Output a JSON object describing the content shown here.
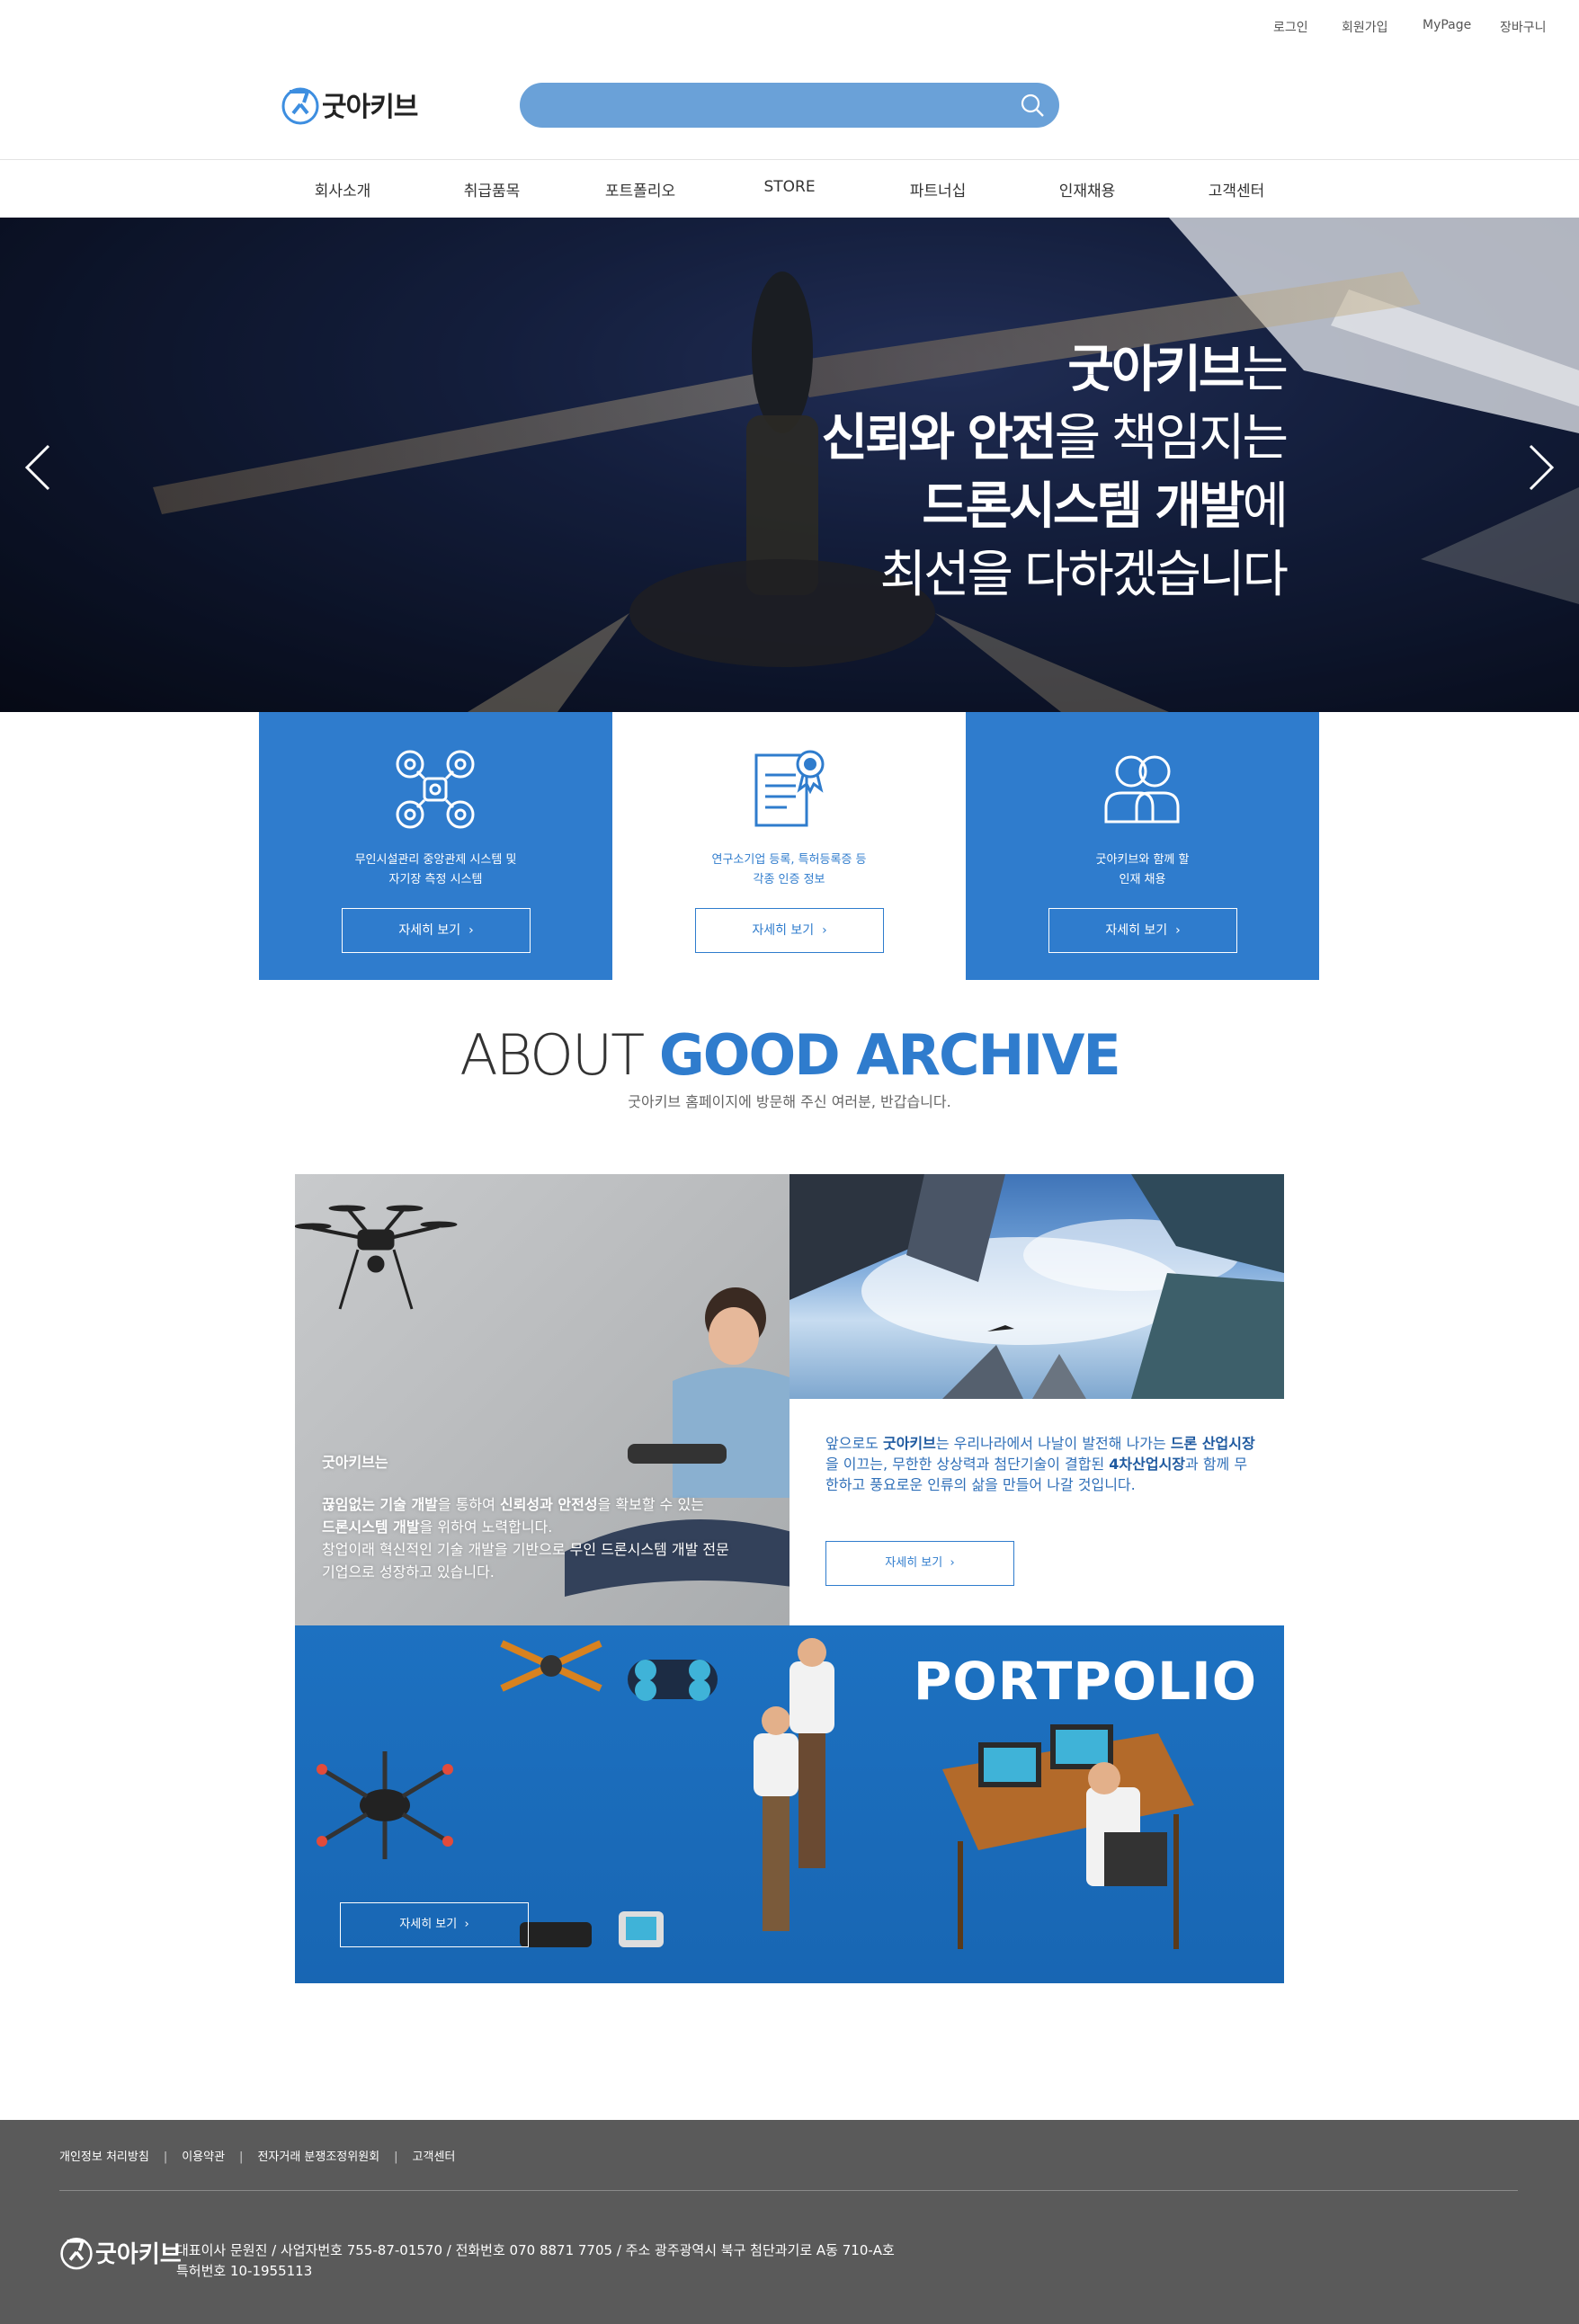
{
  "util_links": [
    "로그인",
    "회원가입",
    "MyPage",
    "장바구니"
  ],
  "logo": {
    "text": "굿아키브"
  },
  "search": {
    "placeholder": ""
  },
  "nav": [
    "회사소개",
    "취급품목",
    "포트폴리오",
    "STORE",
    "파트너십",
    "인재채용",
    "고객센터"
  ],
  "hero": {
    "line1_bold": "굿아키브",
    "line1_rest": "는",
    "line2_bold": "신뢰와 안전",
    "line2_rest": "을 책임지는",
    "line3_bold": "드론시스템 개발",
    "line3_rest": "에",
    "line4": "최선을 다하겠습니다"
  },
  "cards": [
    {
      "desc": "무인시설관리 중앙관제 시스템 및\n자기장 측정 시스템",
      "button": "자세히 보기",
      "icon": "drone-icon"
    },
    {
      "desc": "연구소기업 등록, 특허등록증 등\n각종 인증 정보",
      "button": "자세히 보기",
      "icon": "certificate-icon"
    },
    {
      "desc": "굿아키브와 함께 할\n인재 채용",
      "button": "자세히 보기",
      "icon": "people-icon"
    }
  ],
  "about": {
    "title_light": "ABOUT",
    "title_bold": "GOOD ARCHIVE",
    "subtitle": "굿아키브 홈페이지에 방문해 주신 여러분, 반갑습니다.",
    "photo_text": {
      "l1": "굿아키브는",
      "l2a": "끊임없는 기술 개발",
      "l2b": "을 통하여 ",
      "l2c": "신뢰성과 안전성",
      "l2d": "을 확보할 수 있는",
      "l3a": "드론시스템 개발",
      "l3b": "을 위하여 노력합니다.",
      "l4": "창업이래 혁신적인 기술 개발을 기반으로 무인 드론시스템 개발 전문",
      "l5": "기업으로 성장하고 있습니다."
    },
    "right_text": {
      "a": "앞으로도 ",
      "b": "굿아키브",
      "c": "는 우리나라에서 나날이 발전해 나가는 ",
      "d": "드론 산업시장",
      "e": "을 이끄는, 무한한 상상력과 첨단기술이 결합된 ",
      "f": "4차산업시장",
      "g": "과 함께 무한하고 풍요로운 인류의 삶을 만들어 나갈 것입니다."
    },
    "button": "자세히 보기"
  },
  "portfolio": {
    "title": "PORTPOLIO",
    "button": "자세히 보기"
  },
  "footer": {
    "links": [
      "개인정보 처리방침",
      "이용약관",
      "전자거래 분쟁조정위원회",
      "고객센터"
    ],
    "logo_text": "굿아키브",
    "info_line1": "대표이사 문원진 / 사업자번호 755-87-01570 / 전화번호 070 8871 7705 / 주소 광주광역시 북구 첨단과기로 A동 710-A호",
    "info_line2": "특허번호 10-1955113"
  },
  "colors": {
    "brand_blue": "#2f7ccd",
    "search_bg": "#6aa1d8",
    "footer_bg": "#5a5a5a"
  }
}
